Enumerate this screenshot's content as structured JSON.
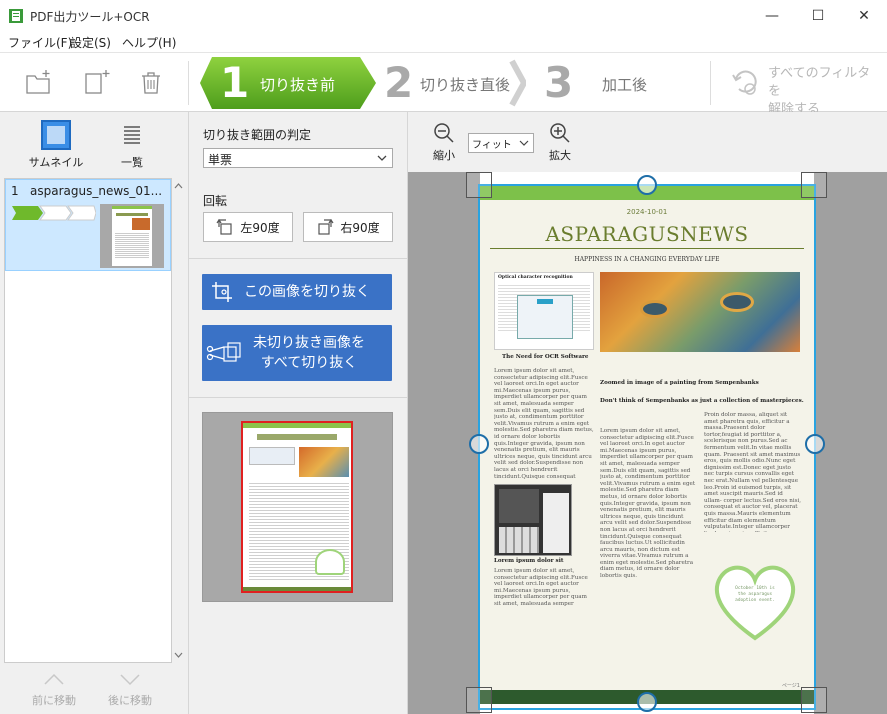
{
  "window": {
    "title": "PDF出力ツール+OCR",
    "minimize": "—",
    "maximize": "☐",
    "close": "✕"
  },
  "menu": {
    "items": [
      "ファイル(F)",
      "設定(S)",
      "ヘルプ(H)"
    ]
  },
  "toolbar": {
    "steps": [
      {
        "number": "1",
        "label": "切り抜き前"
      },
      {
        "number": "2",
        "label": "切り抜き直後"
      },
      {
        "number": "3",
        "label": "加工後"
      }
    ],
    "clear_filters": "すべてのフィルタを\n解除する"
  },
  "left_panel": {
    "thumbnail_label": "サムネイル",
    "list_label": "一覧",
    "items": [
      {
        "index": "1",
        "name": "asparagus_news_01..."
      }
    ],
    "move_up": "前に移動",
    "move_down": "後に移動"
  },
  "crop_panel": {
    "range_label": "切り抜き範囲の判定",
    "range_value": "単票",
    "rotation_label": "回転",
    "rotate_left": "左90度",
    "rotate_right": "右90度",
    "crop_this": "この画像を切り抜く",
    "crop_all": "未切り抜き画像を\nすべて切り抜く"
  },
  "viewer": {
    "zoom_out": "縮小",
    "zoom_in": "拡大",
    "zoom_value": "フィット"
  },
  "newspaper": {
    "date": "2024-10-01",
    "title": "ASPARAGUSNEWS",
    "subtitle": "HAPPINESS IN A CHANGING EVERYDAY LIFE",
    "ocr_heading": "Optical character recognition",
    "need_heading": "The Need for OCR Software",
    "caption": "Zoomed in image of a painting from Sempenbanks",
    "quote": "Don't think of Sempenbanks as just a collection of masterpieces.",
    "heart_text": "October 10th is\nthe asparagus\nadoption event.",
    "page_number": "ページ1",
    "lorem": "Lorem ipsum dolor sit amet, consectetur adipiscing elit.Fusce vel laoreet orci.In eget auctor mi.Maecenas ipsum purus, imperdiet ullamcorper per quam sit amet, malesuada semper sem.Duis elit quam, sagittis sed justo at, condimentum porttitor velit.Vivamus rutrum a enim eget molestie.Sed pharetra diam metus, id ornare dolor lobortis quis.Integer gravida, ipsum non venenatis pretium, elit mauris ultrices neque, quis tincidunt arcu velit sed dolor.Suspendisse non lacus at orci hendrerit tincidunt.Quisque consequat faucibus luctus.Ut sollicitudin arcu mauris, non dictum est viverra vitae.Vivamus rutrum a enim eget molestie.Sed pharetra diam metus, id ornare dolor lobortis quis.",
    "praesent": "Proin dolor massa, aliquet sit amet pharetra quis, efficitur a massa.Praesent dolor tortor,feugiat id porttitor a, scelerisque non purus.Sed ac fermentum velit.In vitae mollis quam. Praesent sit amet maximus eros, quis mollis odio.Nunc eget dignissim est.Donec eget justo nec turpis cursus convallis eget nec erat.Nullam vel pellentesque leo.Proin id euismod turpis, sit amet suscipit mauris.Sed id ullam- corper lectus.Sed eros nisi, consequat et auctor vel, placerat quis massa.Mauris elementum efficitur diam elementum vulputate.Integer ullamcorper ligula quis enim efficitur, non pellentesque nunc facilisis.Sed mollis et arcu vitae suscipit.Etiam scelerisque ante vel nibh bibendum, et venenatis tortor aliquet.",
    "photo_caption": "Lorem ipsum dolor sit"
  },
  "colors": {
    "accent_green": "#6fb92c",
    "button_blue": "#3a72c6",
    "crop_blue": "#29a3e0",
    "selection_blue": "#cde8ff"
  }
}
